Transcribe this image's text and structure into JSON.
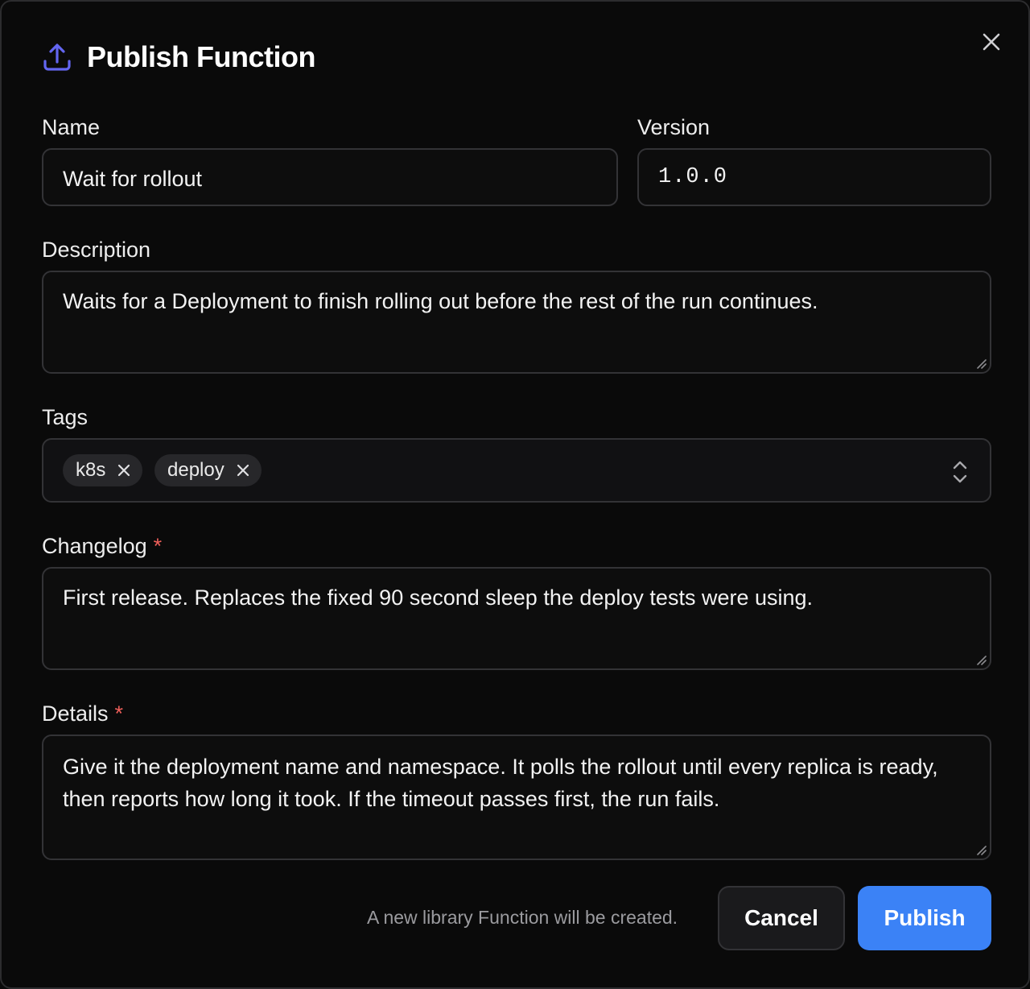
{
  "dialog": {
    "title": "Publish Function",
    "icon": "upload-icon",
    "accent_color": "#6366f1"
  },
  "form": {
    "name": {
      "label": "Name",
      "value": "Wait for rollout"
    },
    "version": {
      "label": "Version",
      "value": "1.0.0"
    },
    "description": {
      "label": "Description",
      "value": "Waits for a Deployment to finish rolling out before the rest of the run continues."
    },
    "tags": {
      "label": "Tags",
      "items": [
        "k8s",
        "deploy"
      ]
    },
    "changelog": {
      "label": "Changelog",
      "required_mark": "*",
      "value": "First release. Replaces the fixed 90 second sleep the deploy tests were using."
    },
    "details": {
      "label": "Details",
      "required_mark": "*",
      "lines": [
        "Give it the deployment name and namespace. It polls the rollout until every replica is ready,",
        "then reports how long it took. If the timeout passes first, the run fails."
      ]
    }
  },
  "footer": {
    "note": "A new library Function will be created.",
    "cancel_label": "Cancel",
    "publish_label": "Publish",
    "publish_color": "#3b82f6"
  }
}
